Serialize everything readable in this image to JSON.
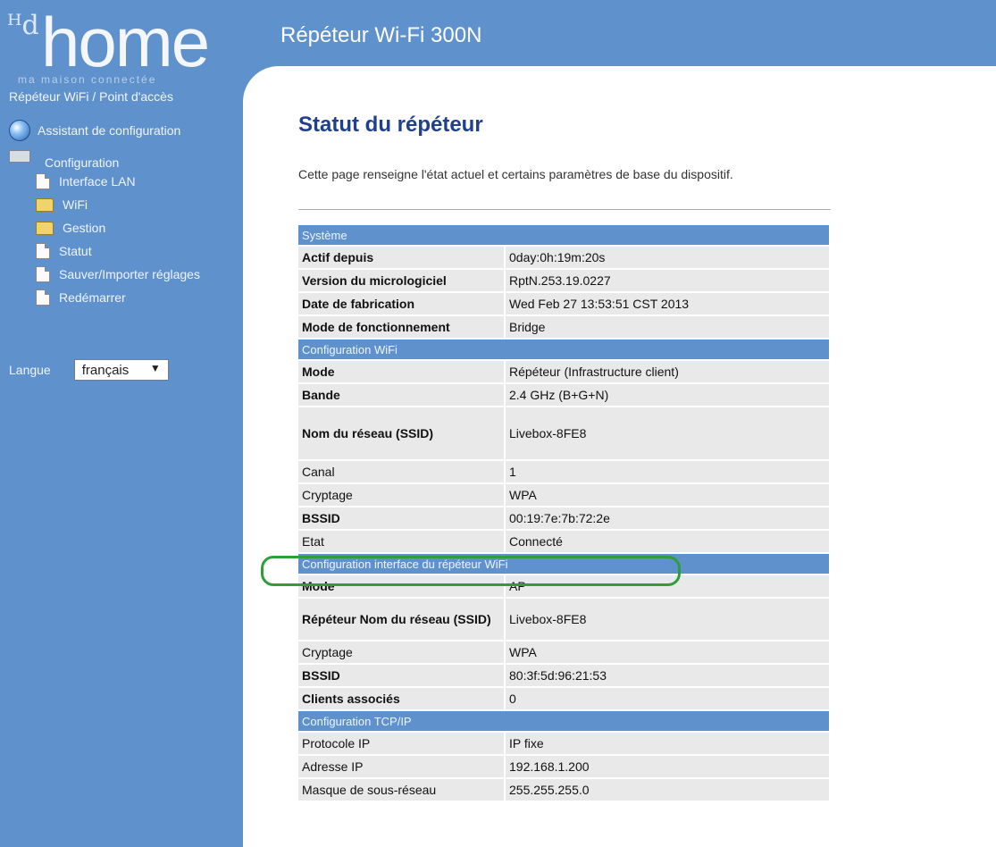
{
  "brand": {
    "prefix": "ᴴd",
    "logo": "home",
    "tagline": "ma maison connectée"
  },
  "header": {
    "title": "Répéteur Wi-Fi 300N"
  },
  "sidebar": {
    "subtitle": "Répéteur WiFi / Point d'accès",
    "wizard": "Assistant de configuration",
    "config": "Configuration",
    "items": [
      {
        "label": "Interface LAN",
        "icon": "page"
      },
      {
        "label": "WiFi",
        "icon": "folder"
      },
      {
        "label": "Gestion",
        "icon": "folder"
      },
      {
        "label": "Statut",
        "icon": "page"
      },
      {
        "label": "Sauver/Importer réglages",
        "icon": "page"
      },
      {
        "label": "Redémarrer",
        "icon": "page"
      }
    ],
    "language_label": "Langue",
    "language_value": "français"
  },
  "main": {
    "title": "Statut du répéteur",
    "intro": "Cette page renseigne l'état actuel et certains paramètres de base du dispositif."
  },
  "sections": {
    "system": "Système",
    "wifi": "Configuration WiFi",
    "repeater": "Configuration interface du répéteur WiFi",
    "tcpip": "Configuration TCP/IP"
  },
  "system": {
    "uptime_label": "Actif depuis",
    "uptime": "0day:0h:19m:20s",
    "firmware_label": "Version du micrologiciel",
    "firmware": "RptN.253.19.0227",
    "build_label": "Date de fabrication",
    "build": "Wed Feb 27 13:53:51 CST 2013",
    "opmode_label": "Mode de fonctionnement",
    "opmode": "Bridge"
  },
  "wifi": {
    "mode_label": "Mode",
    "mode": "Répéteur (Infrastructure client)",
    "band_label": "Bande",
    "band": "2.4 GHz (B+G+N)",
    "ssid_label": "Nom du réseau (SSID)",
    "ssid": "Livebox-8FE8",
    "channel_label": "Canal",
    "channel": "1",
    "encryption_label": "Cryptage",
    "encryption": "WPA",
    "bssid_label": "BSSID",
    "bssid": "00:19:7e:7b:72:2e",
    "state_label": "Etat",
    "state": "Connecté"
  },
  "repeater": {
    "mode_label": "Mode",
    "mode": "AP",
    "ssid_label": "Répéteur Nom du réseau (SSID)",
    "ssid": "Livebox-8FE8",
    "encryption_label": "Cryptage",
    "encryption": "WPA",
    "bssid_label": "BSSID",
    "bssid": "80:3f:5d:96:21:53",
    "clients_label": "Clients associés",
    "clients": "0"
  },
  "tcpip": {
    "protocol_label": "Protocole IP",
    "protocol": "IP fixe",
    "ip_label": "Adresse IP",
    "ip": "192.168.1.200",
    "mask_label": "Masque de sous-réseau",
    "mask": "255.255.255.0"
  },
  "colors": {
    "accent": "#5f92cd",
    "title": "#1f3f8f",
    "highlight": "#2e9e3a"
  }
}
